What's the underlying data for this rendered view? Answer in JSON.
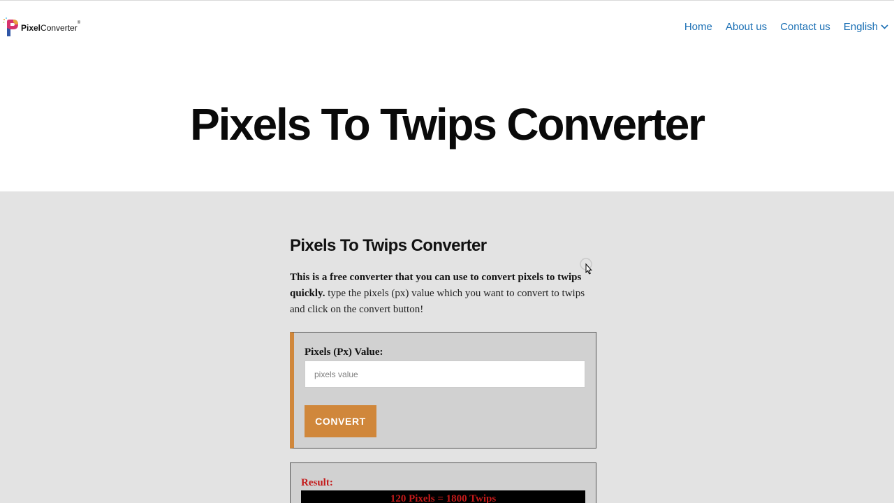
{
  "logo": {
    "bold": "Pixel",
    "regular": "Converter",
    "mark": "®"
  },
  "nav": {
    "items": [
      {
        "label": "Home"
      },
      {
        "label": "About us"
      },
      {
        "label": "Contact us"
      },
      {
        "label": "English",
        "icon": "chevron-down-icon"
      }
    ]
  },
  "hero": {
    "title": "Pixels To Twips Converter"
  },
  "main": {
    "title": "Pixels To Twips Converter",
    "description_bold": "This is a free converter that you can use to convert pixels to twips quickly.",
    "description_regular": " type the pixels (px) value which you want to convert to twips and click on the convert button!"
  },
  "converter": {
    "label": "Pixels (Px) Value:",
    "input_value": "",
    "placeholder": "pixels value",
    "button_label": "CONVERT"
  },
  "result": {
    "label": "Result:",
    "text": "120 Pixels = 1800 Twips"
  },
  "colors": {
    "accent": "#d0873b",
    "link": "#1a6fb4",
    "result_text": "#c41a1a",
    "content_bg": "#e3e3e3"
  }
}
